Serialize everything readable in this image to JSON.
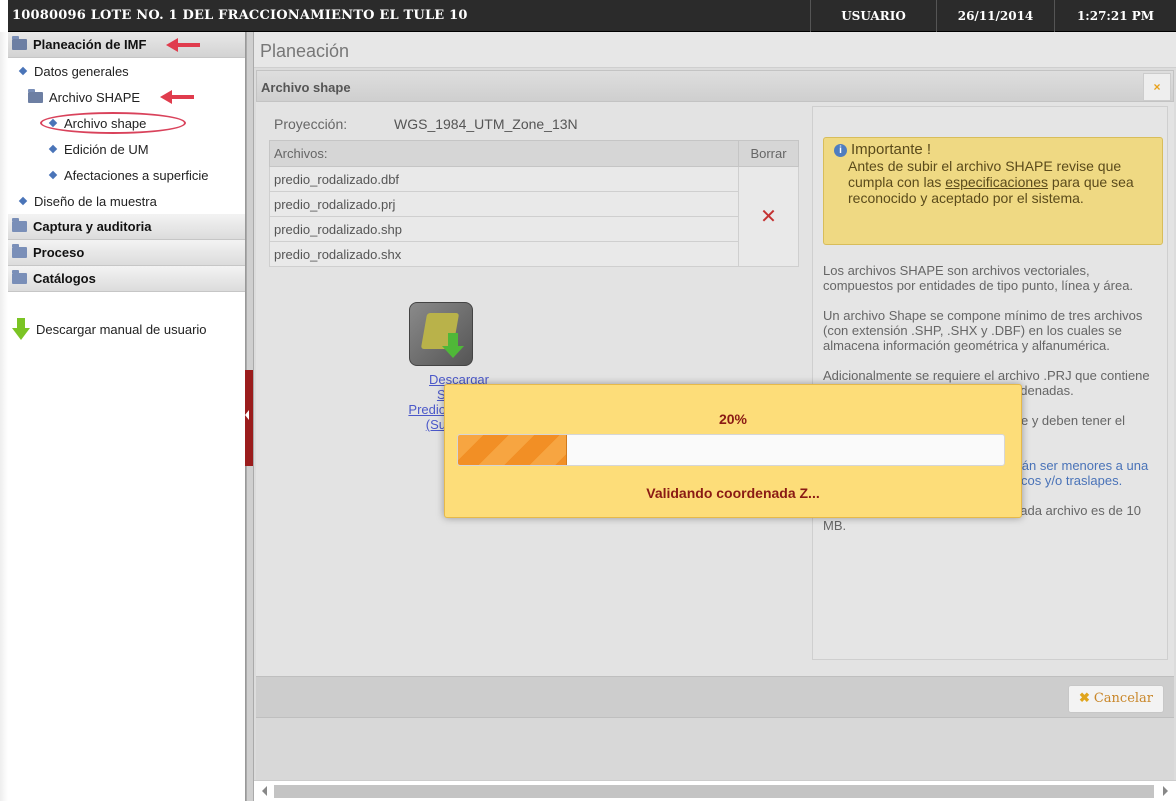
{
  "topbar": {
    "title": "10080096 LOTE NO. 1 DEL FRACCIONAMIENTO EL TULE 10",
    "user": "USUARIO",
    "date": "26/11/2014",
    "time": "1:27:21 PM"
  },
  "sidebar": {
    "sections": {
      "planeacion": "Planeación de IMF",
      "captura": "Captura y auditoria",
      "proceso": "Proceso",
      "catalogos": "Catálogos"
    },
    "items": {
      "datos": "Datos generales",
      "archivo_shape_folder": "Archivo SHAPE",
      "archivo_shape": "Archivo shape",
      "edicion": "Edición de UM",
      "afectaciones": "Afectaciones a superficie",
      "diseno": "Diseño de la muestra"
    },
    "download_manual": "Descargar manual de usuario"
  },
  "main": {
    "title": "Planeación",
    "panel_title": "Archivo shape",
    "close": "×",
    "projection_label": "Proyección:",
    "projection_value": "WGS_1984_UTM_Zone_13N",
    "files_header": "Archivos:",
    "delete_header": "Borrar",
    "files": [
      "predio_rodalizado.dbf",
      "predio_rodalizado.prj",
      "predio_rodalizado.shp",
      "predio_rodalizado.shx"
    ],
    "download_lines": [
      "Descargar",
      "SHAPE",
      "Predio rodalizado",
      "(Superficie)"
    ],
    "important": {
      "title": "Importante !",
      "text_a": "Antes de subir el archivo SHAPE revise que cumpla con las ",
      "link": "especificaciones",
      "text_b": " para que sea reconocido y aceptado por el sistema."
    },
    "info": {
      "p1": "Los archivos SHAPE son archivos vectoriales, compuestos por entidades de tipo punto, línea y área.",
      "p2": "Un archivo Shape se compone mínimo de tres archivos (con extensión .SHP, .SHX y .DBF) en los cuales se almacena información geométrica y alfanumérica.",
      "p3": "Adicionalmente se requiere el archivo .PRJ que contiene la información del sistema de coordenadas.",
      "p4": "Los archivos deben de comprimirse y deben tener el mismo nombre en un archivo ZIP",
      "p5": "Las Unidades de Manejo no deberán ser menores a una hectárea y no deben contener huecos y/o traslapes.",
      "p6": "El tamaño máximo permitido por cada archivo es de 10 MB."
    },
    "cancel": "Cancelar"
  },
  "progress": {
    "percent_label": "20%",
    "value": 0.2,
    "message": "Validando coordenada Z..."
  },
  "colors": {
    "accent_red": "#8a1a14",
    "modal_bg": "#fddd79",
    "progress_orange": "#f28f25"
  }
}
